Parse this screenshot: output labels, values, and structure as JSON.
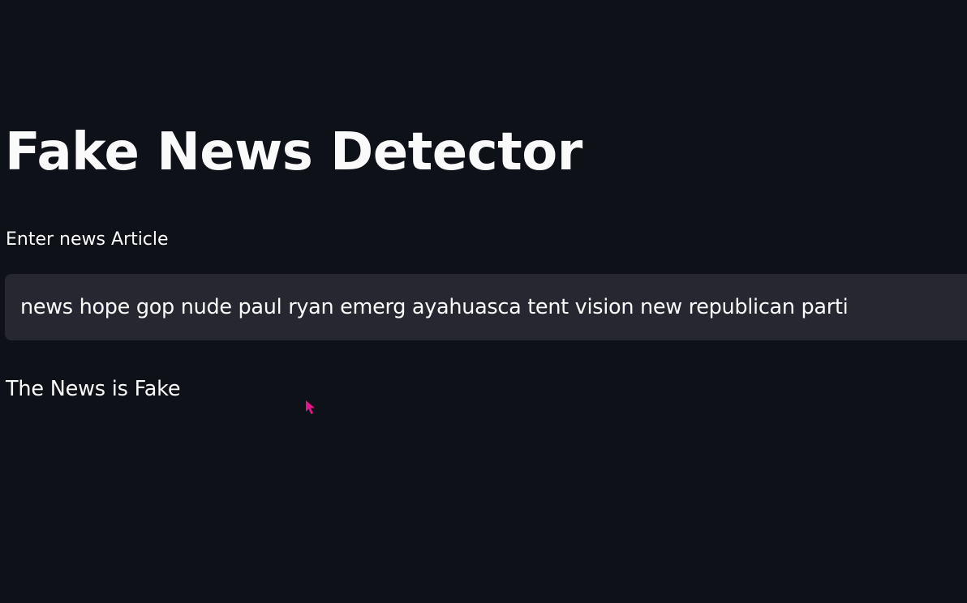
{
  "app": {
    "title": "Fake News Detector"
  },
  "form": {
    "label": "Enter news Article",
    "input_value": "news hope gop nude paul ryan emerg ayahuasca tent vision new republican parti"
  },
  "result": {
    "text": "The News is Fake"
  },
  "icons": {
    "cursor": "mouse-pointer-icon"
  },
  "colors": {
    "background": "#0e1117",
    "input_background": "#262730",
    "text": "#fafafa",
    "cursor": "#e6158c"
  }
}
